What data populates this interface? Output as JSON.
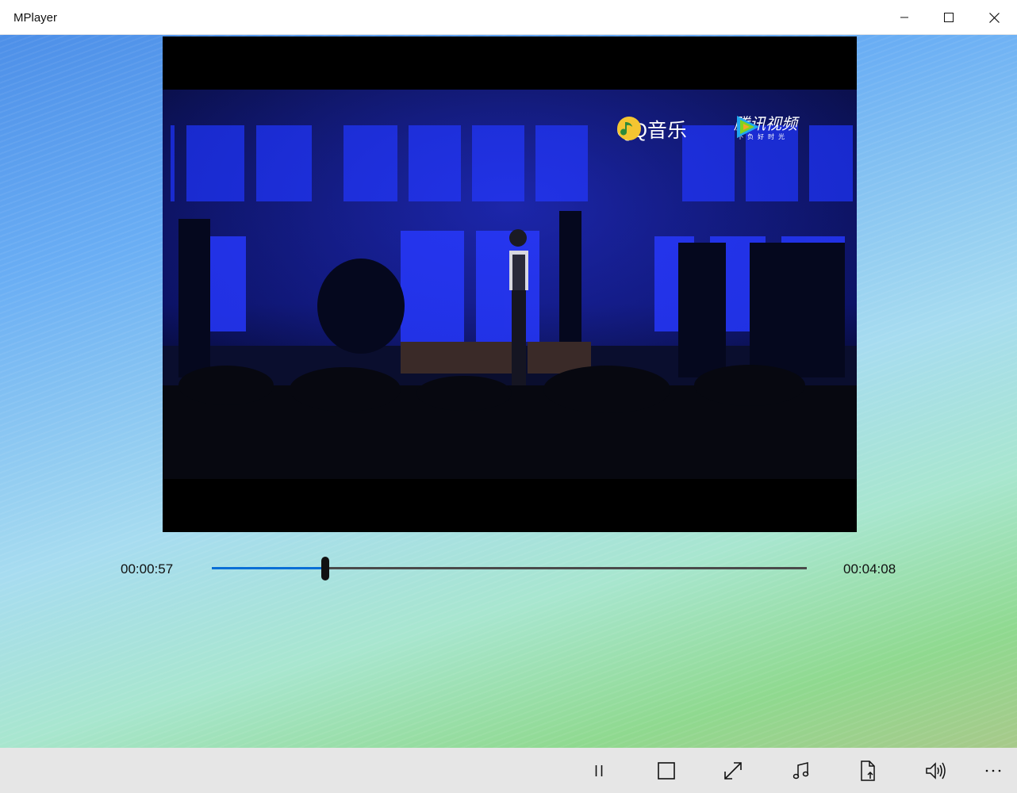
{
  "window": {
    "title": "MPlayer"
  },
  "video": {
    "watermark_qq": "QQ音乐",
    "watermark_tencent": "腾讯视频",
    "watermark_tencent_slogan": "不负好时光"
  },
  "playback": {
    "current_time": "00:00:57",
    "total_time": "00:04:08",
    "progress_fraction": 0.19,
    "accent_color": "#0a6fd6"
  },
  "commands": [
    {
      "icon": "pause-icon"
    },
    {
      "icon": "stop-icon"
    },
    {
      "icon": "fullscreen-icon"
    },
    {
      "icon": "music-note-icon"
    },
    {
      "icon": "open-file-icon"
    },
    {
      "icon": "volume-icon"
    },
    {
      "icon": "more-icon"
    }
  ]
}
